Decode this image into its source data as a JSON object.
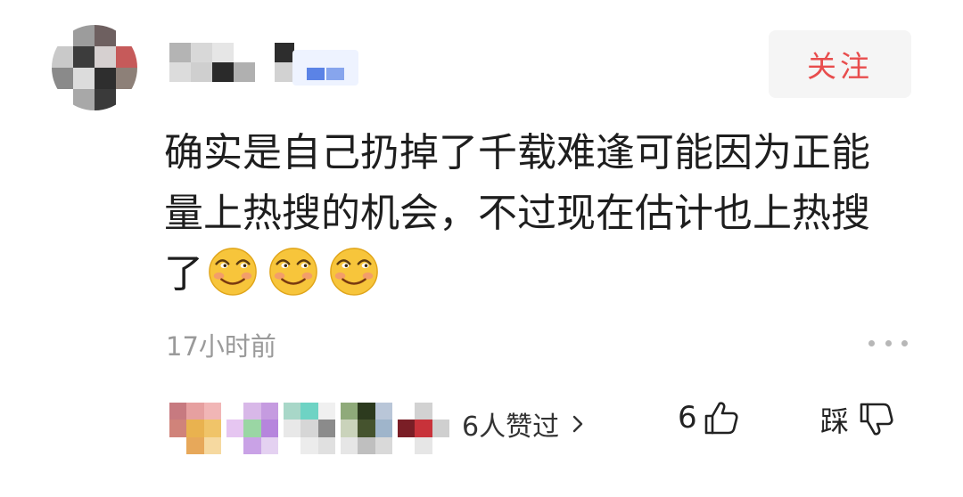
{
  "header": {
    "follow_label": "关注"
  },
  "comment": {
    "lines": [
      "确实是自己扔掉了千载难逢可能因为正能",
      "量上热搜的机会，不过现在估计也上热搜",
      "了"
    ],
    "emoji_icons": [
      "smile-emoji-icon",
      "smile-emoji-icon",
      "smile-emoji-icon"
    ],
    "timestamp": "17小时前"
  },
  "footer": {
    "liked_by_label": "6人赞过",
    "like_count": "6",
    "dislike_label": "踩"
  },
  "colors": {
    "follow_text": "#e84d4d",
    "follow_bg": "#f5f5f5",
    "badge": "#5b83e6",
    "meta_gray": "#9a9a9a"
  }
}
